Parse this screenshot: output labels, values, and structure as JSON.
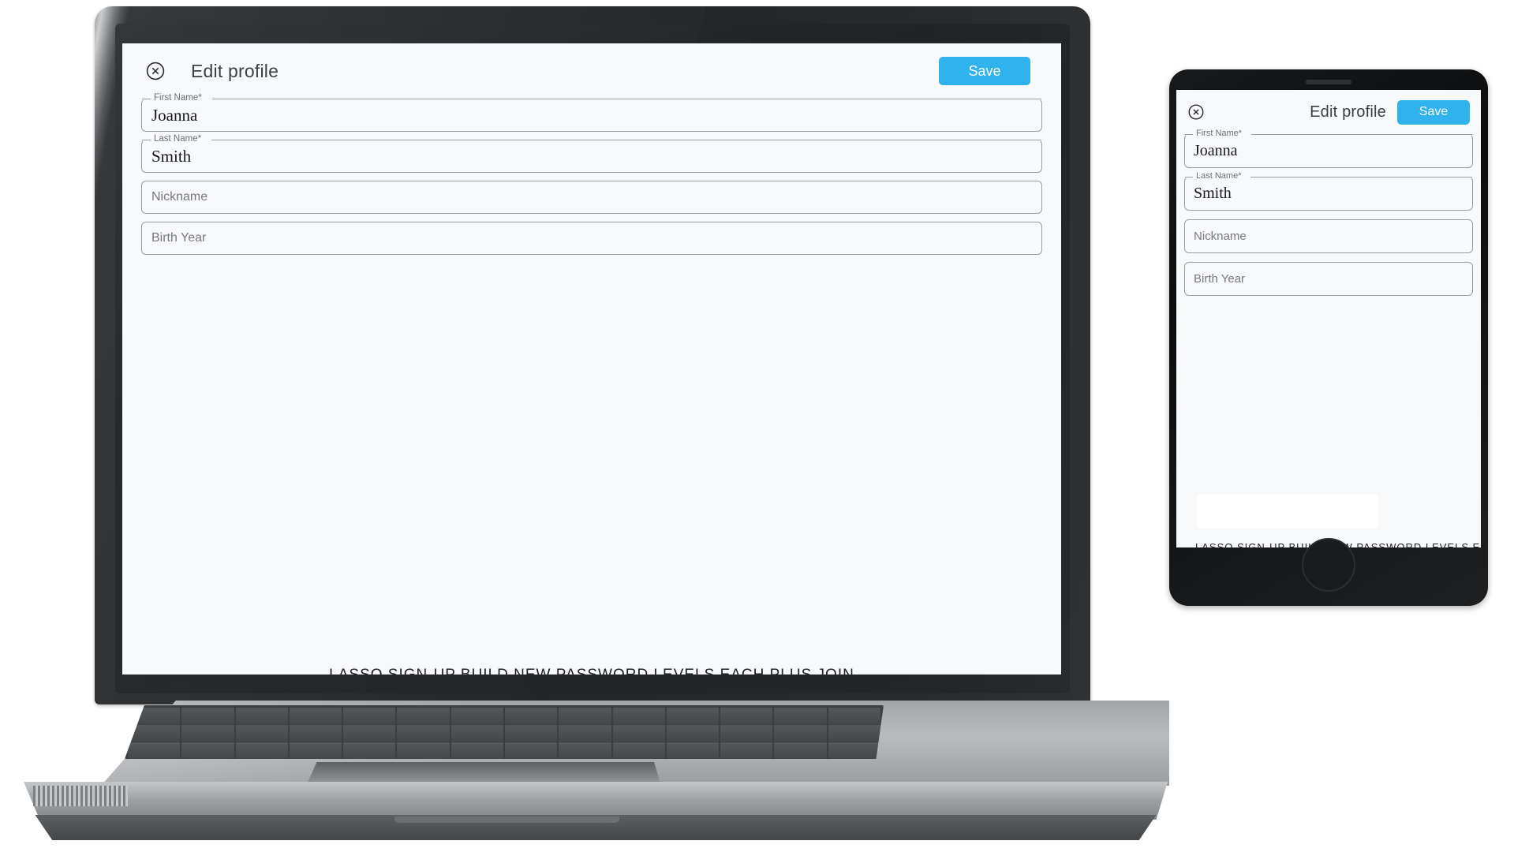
{
  "app": {
    "title": "Edit profile",
    "close_icon": "close-circle-icon",
    "save_label": "Save",
    "accent_color": "#30b2ec",
    "screen_bg": "#f8f9fb",
    "fields": [
      {
        "legend": "First Name*",
        "value": "Joanna",
        "placeholder": "",
        "required": true
      },
      {
        "legend": "Last Name*",
        "value": "Smith",
        "placeholder": "",
        "required": true
      },
      {
        "legend": "",
        "value": "",
        "placeholder": "Nickname",
        "required": false
      },
      {
        "legend": "",
        "value": "",
        "placeholder": "Birth Year",
        "required": false
      }
    ],
    "clipped_footer_text": "LASSO SIGN-UP BUILD NEW PASSWORD LEVELS EACH PLUS JOIN"
  },
  "devices": {
    "laptop_label": "laptop-mockup",
    "phone_label": "phone-mockup"
  }
}
